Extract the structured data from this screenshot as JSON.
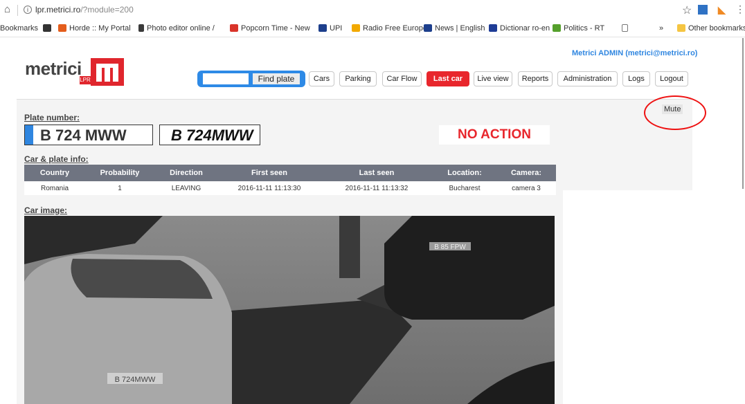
{
  "browser": {
    "url_host": "lpr.metrici.ro",
    "url_path": "/?module=200",
    "bookmarks": [
      {
        "label": "Bookmarks"
      },
      {
        "label": "Horde :: My Portal"
      },
      {
        "label": "Photo editor online /"
      },
      {
        "label": "Popcorn Time - New"
      },
      {
        "label": "UPI"
      },
      {
        "label": "Radio Free Europe"
      },
      {
        "label": "News | English"
      },
      {
        "label": "Dictionar ro-en"
      },
      {
        "label": "Politics - RT"
      }
    ],
    "other_bookmarks": "Other bookmarks",
    "overflow": "»",
    "colors": {
      "ext1": "#2f72c4",
      "ext2": "#f08a24"
    }
  },
  "header": {
    "logo_text": "metrici",
    "logo_badge": "LPR",
    "admin_label": "Metrici ADMIN (metrici@metrici.ro)",
    "search_placeholder": "",
    "find_label": "Find plate",
    "nav": [
      {
        "label": "Cars"
      },
      {
        "label": "Parking"
      },
      {
        "label": "Car Flow"
      },
      {
        "label": "Last car",
        "active": true
      },
      {
        "label": "Live view"
      },
      {
        "label": "Reports"
      },
      {
        "label": "Administration"
      },
      {
        "label": "Logs"
      },
      {
        "label": "Logout"
      }
    ],
    "colors": {
      "brand": "#e0262d",
      "accent": "#2f86e0"
    }
  },
  "main": {
    "mute_label": "Mute",
    "plate_section_title": "Plate number:",
    "plate_text": "B 724 MWW",
    "plate_image_text": "B 724MWW",
    "status": "NO ACTION",
    "info_section_title": "Car & plate info:",
    "table": {
      "headers": [
        "Country",
        "Probability",
        "Direction",
        "First seen",
        "Last seen",
        "Location:",
        "Camera:"
      ],
      "rows": [
        [
          "Romania",
          "1",
          "LEAVING",
          "2016-11-11 11:13:30",
          "2016-11-11 11:13:32",
          "Bucharest",
          "camera 3"
        ]
      ]
    },
    "image_section_title": "Car image:",
    "car_image_plates": [
      "B 724MWW",
      "B 85 FPW"
    ]
  }
}
